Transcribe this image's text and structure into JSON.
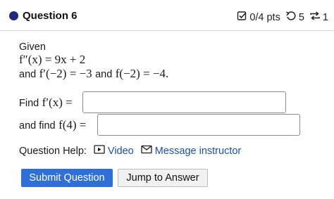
{
  "header": {
    "title": "Question 6",
    "score": "0/4 pts",
    "attempts": "5",
    "retries": "1"
  },
  "problem": {
    "given_label": "Given",
    "eq1": "f″(x) = 9x + 2",
    "and1": "and",
    "eq2": "f′(−2) = −3",
    "and2": "and",
    "eq3": "f(−2) = −4."
  },
  "inputs": {
    "find_label": "Find",
    "find_expr": "f′(x) =",
    "find_value": "",
    "andfind_label": "and find",
    "andfind_expr": "f(4) =",
    "andfind_value": ""
  },
  "help": {
    "label": "Question Help:",
    "video": "Video",
    "message": "Message instructor"
  },
  "buttons": {
    "submit": "Submit Question",
    "jump": "Jump to Answer"
  },
  "colors": {
    "accent": "#2f6fd6",
    "link": "#1d4fa8",
    "dot": "#1e2a7a"
  }
}
